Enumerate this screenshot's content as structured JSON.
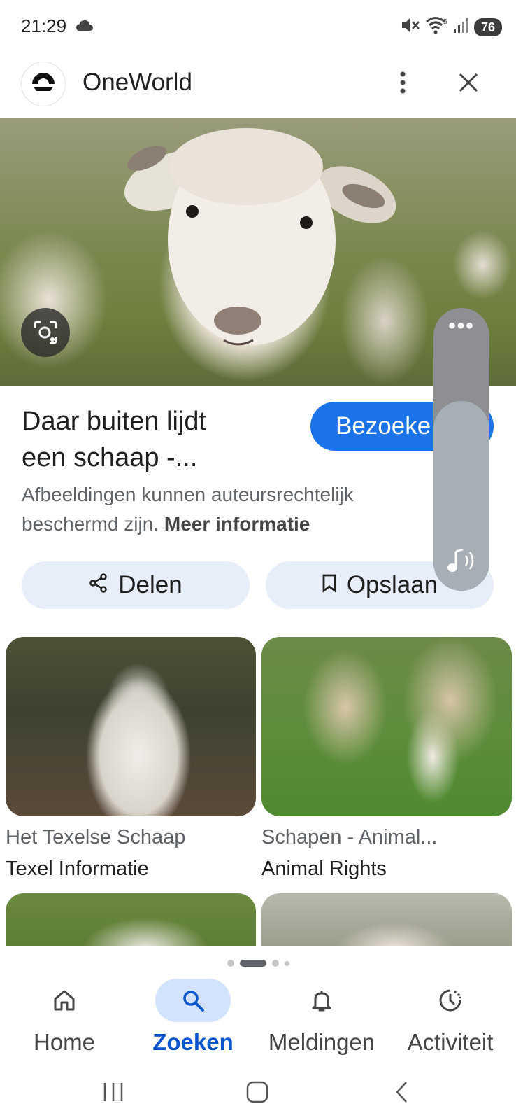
{
  "status_bar": {
    "time": "21:29",
    "battery": "76",
    "icons": [
      "cloud-icon",
      "mute-icon",
      "wifi-icon",
      "signal-icon",
      "battery-icon"
    ]
  },
  "header": {
    "app_name": "OneWorld",
    "icons": [
      "oneworld-logo-icon",
      "more-vert-icon",
      "close-icon"
    ]
  },
  "result": {
    "title_line1": "Daar buiten lijdt",
    "title_line2": "een schaap -...",
    "visit_label": "Bezoeke",
    "copyright_text": "Afbeeldingen kunnen auteursrechtelijk beschermd zijn.",
    "more_info_label": "Meer informatie",
    "share_label": "Delen",
    "save_label": "Opslaan"
  },
  "sound_panel": {
    "menu_label": "•••",
    "level": 0.67,
    "icon": "sound-icon"
  },
  "grid": {
    "items": [
      {
        "title": "Het Texelse Schaap",
        "source": "Texel Informatie"
      },
      {
        "title": "Schapen - Animal...",
        "source": "Animal Rights"
      }
    ]
  },
  "page_indicator": {
    "count": 4,
    "active": 2
  },
  "bottom_nav": {
    "items": [
      {
        "label": "Home",
        "icon": "home-icon"
      },
      {
        "label": "Zoeken",
        "icon": "search-icon"
      },
      {
        "label": "Meldingen",
        "icon": "bell-icon"
      },
      {
        "label": "Activiteit",
        "icon": "activity-icon"
      }
    ],
    "active_index": 1
  },
  "colors": {
    "accent": "#1a73e8",
    "active_nav": "#0b57d0",
    "chip_bg": "#e8eef9"
  }
}
